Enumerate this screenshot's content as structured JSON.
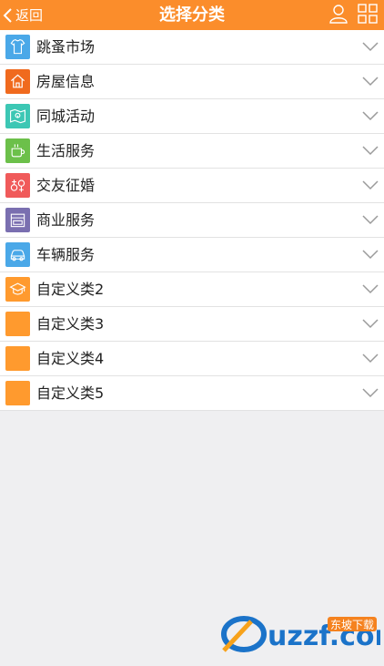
{
  "header": {
    "back_label": "返回",
    "title": "选择分类",
    "bg_color": "#fb8d2b"
  },
  "categories": [
    {
      "label": "跳蚤市场",
      "icon": "tshirt-icon",
      "color": "#4aa8e8"
    },
    {
      "label": "房屋信息",
      "icon": "house-icon",
      "color": "#f06a1e"
    },
    {
      "label": "同城活动",
      "icon": "map-icon",
      "color": "#3cc7b4"
    },
    {
      "label": "生活服务",
      "icon": "cup-icon",
      "color": "#6cc04a"
    },
    {
      "label": "交友征婚",
      "icon": "gender-icon",
      "color": "#f05a5a"
    },
    {
      "label": "商业服务",
      "icon": "store-icon",
      "color": "#7a6fb0"
    },
    {
      "label": "车辆服务",
      "icon": "car-icon",
      "color": "#4aa8e8"
    },
    {
      "label": "自定义类2",
      "icon": "graduation-cap-icon",
      "color": "#ff9a2e"
    },
    {
      "label": "自定义类3",
      "icon": "blank-icon",
      "color": "#ff9a2e"
    },
    {
      "label": "自定义类4",
      "icon": "blank-icon",
      "color": "#ff9a2e"
    },
    {
      "label": "自定义类5",
      "icon": "blank-icon",
      "color": "#ff9a2e"
    }
  ],
  "watermark": {
    "brand": "uzzf.com",
    "tagline": "东坡下载"
  }
}
